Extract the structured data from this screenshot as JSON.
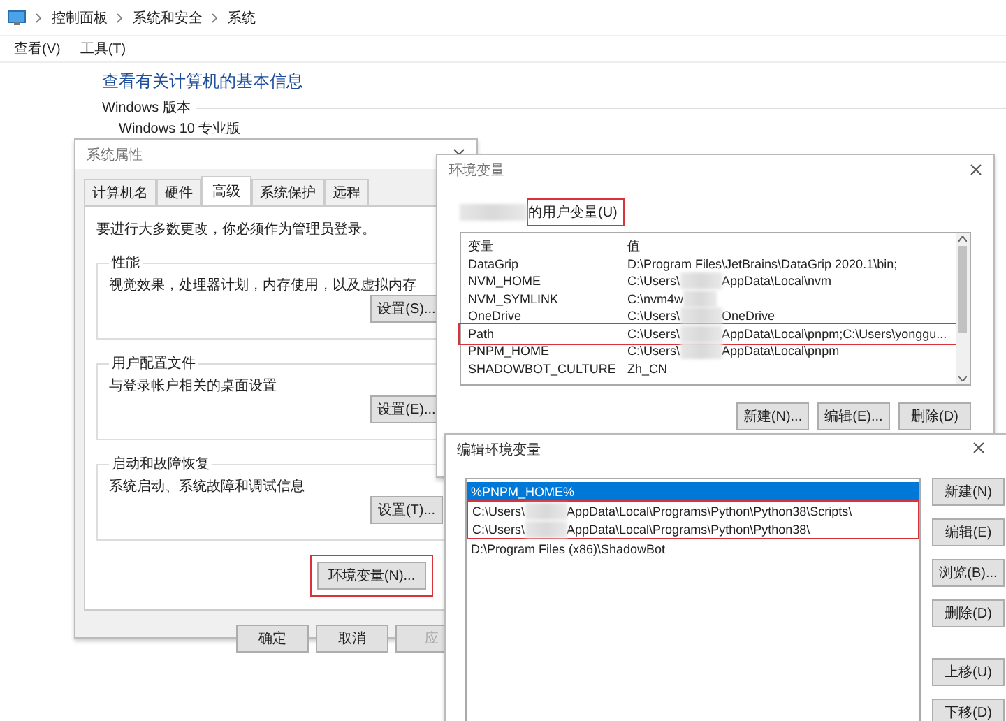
{
  "explorer": {
    "breadcrumb": [
      "控制面板",
      "系统和安全",
      "系统"
    ],
    "menu": [
      "查看(V)",
      "工具(T)"
    ],
    "heading": "查看有关计算机的基本信息",
    "section_label": "Windows 版本",
    "edition": "Windows 10 专业版"
  },
  "system_properties": {
    "title": "系统属性",
    "tabs": [
      {
        "label": "计算机名",
        "selected": false
      },
      {
        "label": "硬件",
        "selected": false
      },
      {
        "label": "高级",
        "selected": true
      },
      {
        "label": "系统保护",
        "selected": false
      },
      {
        "label": "远程",
        "selected": false
      }
    ],
    "notice": "要进行大多数更改，你必须作为管理员登录。",
    "groups": [
      {
        "title": "性能",
        "description": "视觉效果，处理器计划，内存使用，以及虚拟内存",
        "button": "设置(S)..."
      },
      {
        "title": "用户配置文件",
        "description": "与登录帐户相关的桌面设置",
        "button": "设置(E)..."
      },
      {
        "title": "启动和故障恢复",
        "description": "系统启动、系统故障和调试信息",
        "button": "设置(T)..."
      }
    ],
    "env_button": {
      "label": "环境变量(N)...",
      "highlighted": true
    },
    "buttons": [
      {
        "label": "确定",
        "disabled": false
      },
      {
        "label": "取消",
        "disabled": false
      },
      {
        "label": "应",
        "disabled": true
      }
    ]
  },
  "env_dialog": {
    "title": "环境变量",
    "user_vars_label": {
      "text": "的用户变量(U)",
      "redacted": true,
      "highlighted": true
    },
    "columns": [
      "变量",
      "值"
    ],
    "rows": [
      {
        "name": "DataGrip",
        "value": [
          "D:\\Program Files\\JetBrains\\DataGrip 2020.1\\bin;"
        ],
        "redacted": false,
        "highlighted": false
      },
      {
        "name": "NVM_HOME",
        "value": [
          "C:\\Users\\",
          "AppData\\Local\\nvm"
        ],
        "redacted": true,
        "highlighted": false
      },
      {
        "name": "NVM_SYMLINK",
        "value": [
          "C:\\nvm4w"
        ],
        "redacted": true,
        "highlighted": false
      },
      {
        "name": "OneDrive",
        "value": [
          "C:\\Users\\",
          "OneDrive"
        ],
        "redacted": true,
        "highlighted": false
      },
      {
        "name": "Path",
        "value": [
          "C:\\Users\\",
          "AppData\\Local\\pnpm;C:\\Users\\yonggu..."
        ],
        "redacted": true,
        "highlighted": true
      },
      {
        "name": "PNPM_HOME",
        "value": [
          "C:\\Users\\",
          "AppData\\Local\\pnpm"
        ],
        "redacted": true,
        "highlighted": false
      },
      {
        "name": "SHADOWBOT_CULTURE",
        "value": [
          "Zh_CN"
        ],
        "redacted": false,
        "highlighted": false
      }
    ],
    "buttons": [
      "新建(N)...",
      "编辑(E)...",
      "删除(D)"
    ]
  },
  "edit_dialog": {
    "title": "编辑环境变量",
    "entries": [
      {
        "parts": [
          "%PNPM_HOME%"
        ],
        "redacted": false,
        "selected": true,
        "highlighted": false
      },
      {
        "parts": [
          "C:\\Users\\",
          "AppData\\Local\\Programs\\Python\\Python38\\Scripts\\"
        ],
        "redacted": true,
        "selected": false,
        "highlighted": true
      },
      {
        "parts": [
          "C:\\Users\\",
          "AppData\\Local\\Programs\\Python\\Python38\\"
        ],
        "redacted": true,
        "selected": false,
        "highlighted": true
      },
      {
        "parts": [
          "D:\\Program Files (x86)\\ShadowBot"
        ],
        "redacted": false,
        "selected": false,
        "highlighted": false
      }
    ],
    "button_groups": [
      [
        "新建(N)",
        "编辑(E)",
        "浏览(B)...",
        "删除(D)"
      ],
      [
        "上移(U)",
        "下移(D)"
      ]
    ]
  }
}
